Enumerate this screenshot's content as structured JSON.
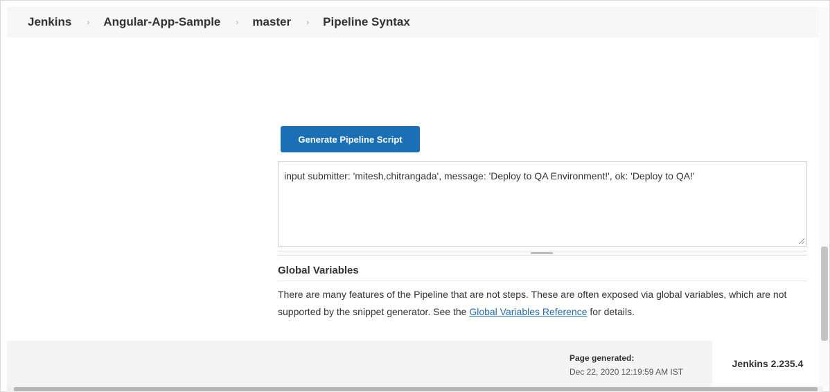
{
  "breadcrumb": [
    "Jenkins",
    "Angular-App-Sample",
    "master",
    "Pipeline Syntax"
  ],
  "generate_button": "Generate Pipeline Script",
  "script_output": "input submitter: 'mitesh,chitrangada', message: 'Deploy to QA Environment!', ok: 'Deploy to QA!'",
  "global_variables": {
    "title": "Global Variables",
    "text_before": "There are many features of the Pipeline that are not steps. These are often exposed via global variables, which are not supported by the snippet generator. See the ",
    "link": "Global Variables Reference",
    "text_after": " for details."
  },
  "footer": {
    "page_generated_label": "Page generated:",
    "page_generated_value": "Dec 22, 2020 12:19:59 AM IST",
    "version": "Jenkins 2.235.4"
  },
  "colors": {
    "button": "#1b6fb5",
    "link": "#2a6aa8"
  }
}
